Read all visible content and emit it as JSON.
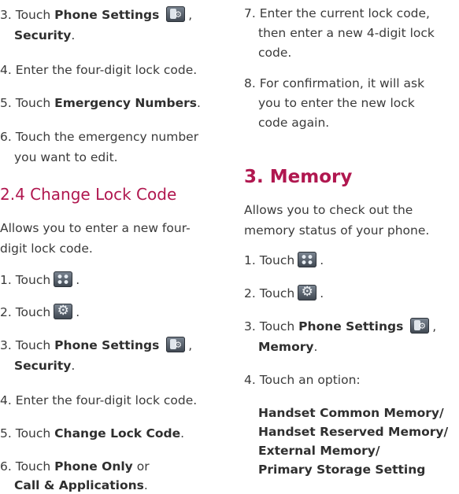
{
  "left": {
    "s3a": {
      "num": "3.",
      "pre": "Touch",
      "bold": "Phone Settings",
      "icon": "phone-settings-icon",
      "after": ",",
      "cont_bold": "Security",
      "cont_after": "."
    },
    "s4a": {
      "text": "4. Enter the four-digit lock code."
    },
    "s5a": {
      "num": "5.",
      "pre": "Touch",
      "bold": "Emergency Numbers",
      "after": "."
    },
    "s6a": {
      "line1": "6. Touch the emergency number",
      "line2": "you want to edit."
    },
    "heading": "2.4 Change Lock Code",
    "intro": {
      "line1": "Allows you to enter a new four-",
      "line2": "digit lock code."
    },
    "s1": {
      "text": "1. Touch",
      "icon": "apps-grid-icon",
      "after": "."
    },
    "s2": {
      "text": "2. Touch",
      "icon": "gear-settings-icon",
      "after": "."
    },
    "s3b": {
      "num": "3.",
      "pre": "Touch",
      "bold": "Phone Settings",
      "icon": "phone-settings-icon",
      "after": ",",
      "cont_bold": "Security",
      "cont_after": "."
    },
    "s4b": {
      "text": "4. Enter the four-digit lock code."
    },
    "s5b": {
      "num": "5.",
      "pre": "Touch",
      "bold": "Change Lock Code",
      "after": "."
    },
    "s6b": {
      "num": "6.",
      "pre": "Touch",
      "bold": "Phone Only",
      "mid": "or",
      "cont_bold": "Call & Applications",
      "cont_after": "."
    }
  },
  "right": {
    "s7": {
      "line1": "7. Enter the current lock code,",
      "line2": "then enter a new 4-digit lock",
      "line3": "code."
    },
    "s8": {
      "line1": "8. For confirmation, it will ask",
      "line2": "you to enter the new lock",
      "line3": "code again."
    },
    "heading": "3. Memory",
    "intro": {
      "line1": "Allows you to check out the",
      "line2": "memory status of your phone."
    },
    "s1": {
      "text": "1. Touch",
      "icon": "apps-grid-icon",
      "after": "."
    },
    "s2": {
      "text": "2. Touch",
      "icon": "gear-settings-icon",
      "after": "."
    },
    "s3": {
      "num": "3.",
      "pre": "Touch",
      "bold": "Phone Settings",
      "icon": "phone-settings-icon",
      "after": ",",
      "cont_bold": "Memory",
      "cont_after": "."
    },
    "s4": {
      "text": "4. Touch an option:"
    },
    "options": {
      "o1": "Handset Common Memory/",
      "o2": "Handset Reserved Memory/",
      "o3": "External Memory/",
      "o4": "Primary Storage Setting"
    }
  },
  "colors": {
    "heading": "#b0174f",
    "text": "#3a3a3a"
  }
}
